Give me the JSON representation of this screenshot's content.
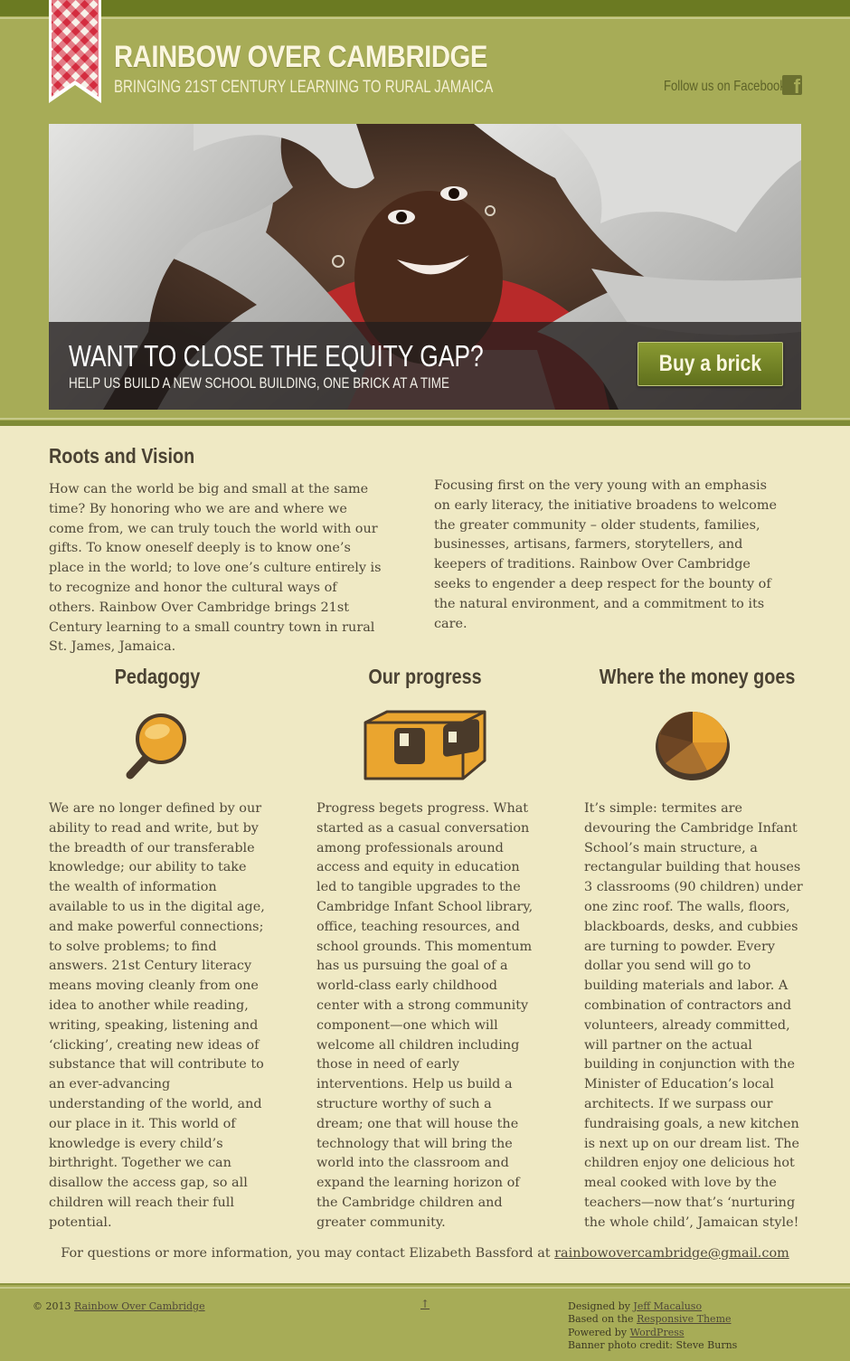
{
  "header": {
    "site_title": "RAINBOW OVER CAMBRIDGE",
    "tagline": "BRINGING 21ST CENTURY LEARNING TO RURAL JAMAICA",
    "follow_label": "Follow us on Facebook"
  },
  "hero": {
    "title": "WANT TO CLOSE THE EQUITY GAP?",
    "subtitle": "HELP US BUILD A NEW SCHOOL BUILDING, ONE BRICK AT A TIME",
    "button_label": "Buy a brick"
  },
  "roots": {
    "title": "Roots and Vision",
    "left_text": "How can the world be big and small at the same time? By honoring who we are and where we come from, we can truly touch the world with our gifts. To know oneself deeply is to know one’s place in the world; to love one’s culture entirely is to recognize and honor the cultural ways of others. Rainbow Over Cambridge brings 21st Century learning to a small country town in rural St. James, Jamaica.",
    "right_text": "Focusing first on the very young with an emphasis on early literacy, the initiative broadens to welcome the greater community – older students, families, businesses, artisans, farmers, storytellers, and keepers of traditions. Rainbow Over Cambridge seeks to engender a deep respect for the bounty of the natural environment, and a commitment to its care."
  },
  "columns": [
    {
      "title": "Pedagogy",
      "icon": "magnifier-icon",
      "text": "We are no longer defined by our ability to read and write, but by the breadth of our transferable knowledge; our ability to take the wealth of information available to us in the digital age, and make powerful connections; to solve problems; to find answers. 21st Century literacy means moving cleanly from one idea to another while reading, writing, speaking, listening and ‘clicking’, creating new ideas of substance that will contribute to an ever-advancing understanding of the world, and our place in it. This world of knowledge is every child’s birthright. Together we can disallow the access gap, so all children will reach their full potential."
    },
    {
      "title": "Our progress",
      "icon": "brick-icon",
      "text": "Progress begets progress. What started as a casual conversation among professionals around access and equity in education led to tangible upgrades to the Cambridge Infant School library, office, teaching resources, and school grounds. This momentum has us pursuing the goal of a world-class early childhood center with a strong community component—one which will welcome all children including those in need of early interventions. Help us build a structure worthy of such a dream; one that will house the technology that will bring the world into the classroom and expand the learning horizon of the Cambridge children and greater community."
    },
    {
      "title": "Where the money goes",
      "icon": "pie-chart-icon",
      "text": "It’s simple: termites are devouring the Cambridge Infant School’s main structure, a rectangular building that houses 3 classrooms (90 children) under one zinc roof. The walls, floors, blackboards, desks, and cubbies are turning to powder. Every dollar you send will go to building materials and labor. A combination of contractors and volunteers, already committed, will partner on the actual building in conjunction with the Minister of Education’s local architects. If we surpass our fundraising goals, a new kitchen is next up on our dream list. The children enjoy one delicious hot meal cooked with love by the teachers—now that’s ‘nurturing the whole child’, Jamaican style!"
    }
  ],
  "contact": {
    "text": "For questions or more information, you may contact Elizabeth Bassford at",
    "email": "rainbowovercambridge@gmail.com"
  },
  "footer": {
    "copyright_prefix": "© 2013",
    "copyright_link": "Rainbow Over Cambridge",
    "back_to_top": "↑",
    "designed_by_prefix": "Designed by",
    "designed_by_link": "Jeff Macaluso",
    "based_on_prefix": "Based on the",
    "based_on_link": "Responsive Theme",
    "powered_by_prefix": "Powered by",
    "powered_by_link": "WordPress",
    "photo_credit": "Banner photo credit: Steve Burns"
  },
  "colors": {
    "header_green": "#a7ac57",
    "dark_green": "#6b7a22",
    "page_cream": "#efe9c4",
    "accent_orange": "#e5a22d",
    "button_green": "#6f7f24"
  }
}
